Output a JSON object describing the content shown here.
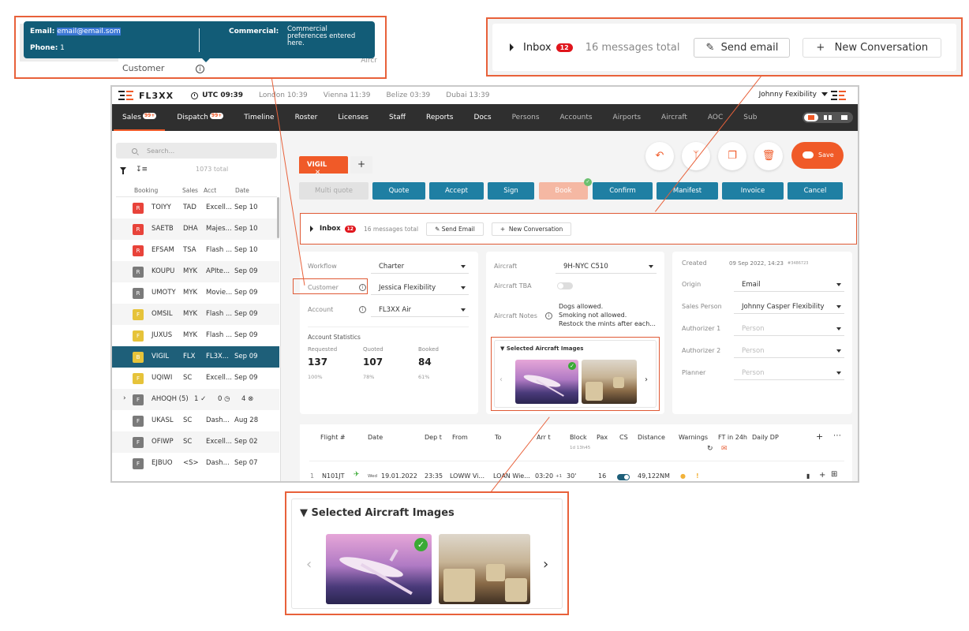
{
  "topbar": {
    "logo_text": "FL3XX",
    "utc_time": "UTC 09:39",
    "timezones": [
      "London 10:39",
      "Vienna 11:39",
      "Belize 03:39",
      "Dubai 13:39"
    ],
    "user_name": "Johnny Fexibility"
  },
  "nav": {
    "items": [
      {
        "label": "Sales",
        "badge": "99+",
        "active": true
      },
      {
        "label": "Dispatch",
        "badge": "99+"
      },
      {
        "label": "Timeline"
      },
      {
        "label": "Roster"
      },
      {
        "label": "Licenses"
      },
      {
        "label": "Staff"
      },
      {
        "label": "Reports"
      },
      {
        "label": "Docs"
      },
      {
        "label": "Persons"
      },
      {
        "label": "Accounts"
      },
      {
        "label": "Airports"
      },
      {
        "label": "Aircraft"
      },
      {
        "label": "AOC"
      },
      {
        "label": "Sub"
      }
    ]
  },
  "sidebar": {
    "search_placeholder": "Search...",
    "total": "1073 total",
    "columns": [
      "Booking",
      "Sales",
      "Acct",
      "Date"
    ],
    "rows": [
      {
        "status": "R",
        "color": "#e8433a",
        "booking": "TOIYY",
        "sales": "TAD",
        "acct": "Excell...",
        "date": "Sep 10"
      },
      {
        "status": "R",
        "color": "#e8433a",
        "booking": "SAETB",
        "sales": "DHA",
        "acct": "Majes...",
        "date": "Sep 10"
      },
      {
        "status": "R",
        "color": "#e8433a",
        "booking": "EFSAM",
        "sales": "TSA",
        "acct": "Flash ...",
        "date": "Sep 10"
      },
      {
        "status": "R",
        "color": "#7a7a7a",
        "booking": "KOUPU",
        "sales": "MYK",
        "acct": "APIte...",
        "date": "Sep 09"
      },
      {
        "status": "R",
        "color": "#7a7a7a",
        "booking": "UMOTY",
        "sales": "MYK",
        "acct": "Movie...",
        "date": "Sep 09"
      },
      {
        "status": "F",
        "color": "#e6c33a",
        "booking": "OMSIL",
        "sales": "MYK",
        "acct": "Flash ...",
        "date": "Sep 09"
      },
      {
        "status": "F",
        "color": "#e6c33a",
        "booking": "JUXUS",
        "sales": "MYK",
        "acct": "Flash ...",
        "date": "Sep 09"
      },
      {
        "status": "B",
        "color": "#e6c33a",
        "booking": "VIGIL",
        "sales": "FLX",
        "acct": "FL3X...",
        "date": "Sep 09",
        "selected": true
      },
      {
        "status": "F",
        "color": "#e6c33a",
        "booking": "UQIWI",
        "sales": "SC",
        "acct": "Excell...",
        "date": "Sep 09"
      },
      {
        "status": "F",
        "color": "#7a7a7a",
        "booking": "AHOQH (5)",
        "sales": "1 ✓",
        "acct": "0 ◷",
        "date": "4 ⊗",
        "group": true
      },
      {
        "status": "F",
        "color": "#7a7a7a",
        "booking": "UKASL",
        "sales": "SC",
        "acct": "Dash...",
        "date": "Aug 28"
      },
      {
        "status": "F",
        "color": "#7a7a7a",
        "booking": "OFIWP",
        "sales": "SC",
        "acct": "Excell...",
        "date": "Sep 02"
      },
      {
        "status": "F",
        "color": "#7a7a7a",
        "booking": "EJBUO",
        "sales": "<S>",
        "acct": "Dash...",
        "date": "Sep 07"
      }
    ]
  },
  "booking_tab": {
    "label": "VIGIL",
    "add": "+"
  },
  "save_label": "Save",
  "actions": [
    "Multi quote",
    "Quote",
    "Accept",
    "Sign",
    "Book",
    "Confirm",
    "Manifest",
    "Invoice",
    "Cancel"
  ],
  "inbox": {
    "label": "Inbox",
    "count": "12",
    "total": "16 messages total",
    "send_email": "Send Email",
    "new_conversation": "New Conversation"
  },
  "left_card": {
    "workflow_label": "Workflow",
    "workflow_value": "Charter",
    "customer_label": "Customer",
    "customer_value": "Jessica Flexibility",
    "account_label": "Account",
    "account_value": "FL3XX Air",
    "stats_title": "Account Statistics",
    "stats": [
      {
        "label": "Requested",
        "value": "137",
        "pct": "100%"
      },
      {
        "label": "Quoted",
        "value": "107",
        "pct": "78%"
      },
      {
        "label": "Booked",
        "value": "84",
        "pct": "61%"
      }
    ]
  },
  "mid_card": {
    "aircraft_label": "Aircraft",
    "aircraft_value": "9H-NYC C510",
    "tba_label": "Aircraft TBA",
    "notes_label": "Aircraft Notes",
    "notes": [
      "Dogs allowed.",
      "Smoking not allowed.",
      "Restock the mints after each..."
    ],
    "images_title": "Selected Aircraft Images"
  },
  "right_card": {
    "created_label": "Created",
    "created_value": "09 Sep 2022, 14:23",
    "created_id": "#3486723",
    "fields": [
      {
        "label": "Origin",
        "value": "Email",
        "placeholder": false
      },
      {
        "label": "Sales Person",
        "value": "Johnny Casper Flexibility",
        "placeholder": false
      },
      {
        "label": "Authorizer 1",
        "value": "Person",
        "placeholder": true
      },
      {
        "label": "Authorizer 2",
        "value": "Person",
        "placeholder": true
      },
      {
        "label": "Planner",
        "value": "Person",
        "placeholder": true
      }
    ]
  },
  "flights": {
    "columns": [
      "Flight #",
      "Date",
      "Dep t",
      "From",
      "To",
      "Arr t",
      "Block",
      "Pax",
      "CS",
      "Distance",
      "Warnings",
      "FT in 24h",
      "Daily DP"
    ],
    "block_sub": "1d 13h45",
    "row": {
      "index": "1",
      "flight": "N101JT",
      "weekday": "Wed",
      "date": "19.01.2022",
      "dep": "23:35",
      "from": "LOWW Vi...",
      "to": "LOAN Wie...",
      "arr": "03:20",
      "arr_plus": "+1",
      "block": "30'",
      "pax": "16",
      "distance": "49,122NM"
    }
  },
  "callout_tooltip": {
    "email_label": "Email:",
    "email_value": "email@email.som",
    "phone_label": "Phone:",
    "phone_value": "1",
    "commercial_label": "Commercial:",
    "commercial_value": "Commercial preferences entered here.",
    "field_label": "Customer",
    "bg_text": "Aircr"
  },
  "callout_inbox": {
    "label": "Inbox",
    "count": "12",
    "total": "16 messages total",
    "send_email": "Send email",
    "new_conversation": "New Conversation"
  },
  "callout_images": {
    "title": "Selected Aircraft Images"
  },
  "colors": {
    "accent": "#f05a28",
    "primary": "#1f7fa3",
    "selected": "#1e5f79",
    "nav": "#2f2f2f",
    "callout_border": "#e8613a"
  }
}
